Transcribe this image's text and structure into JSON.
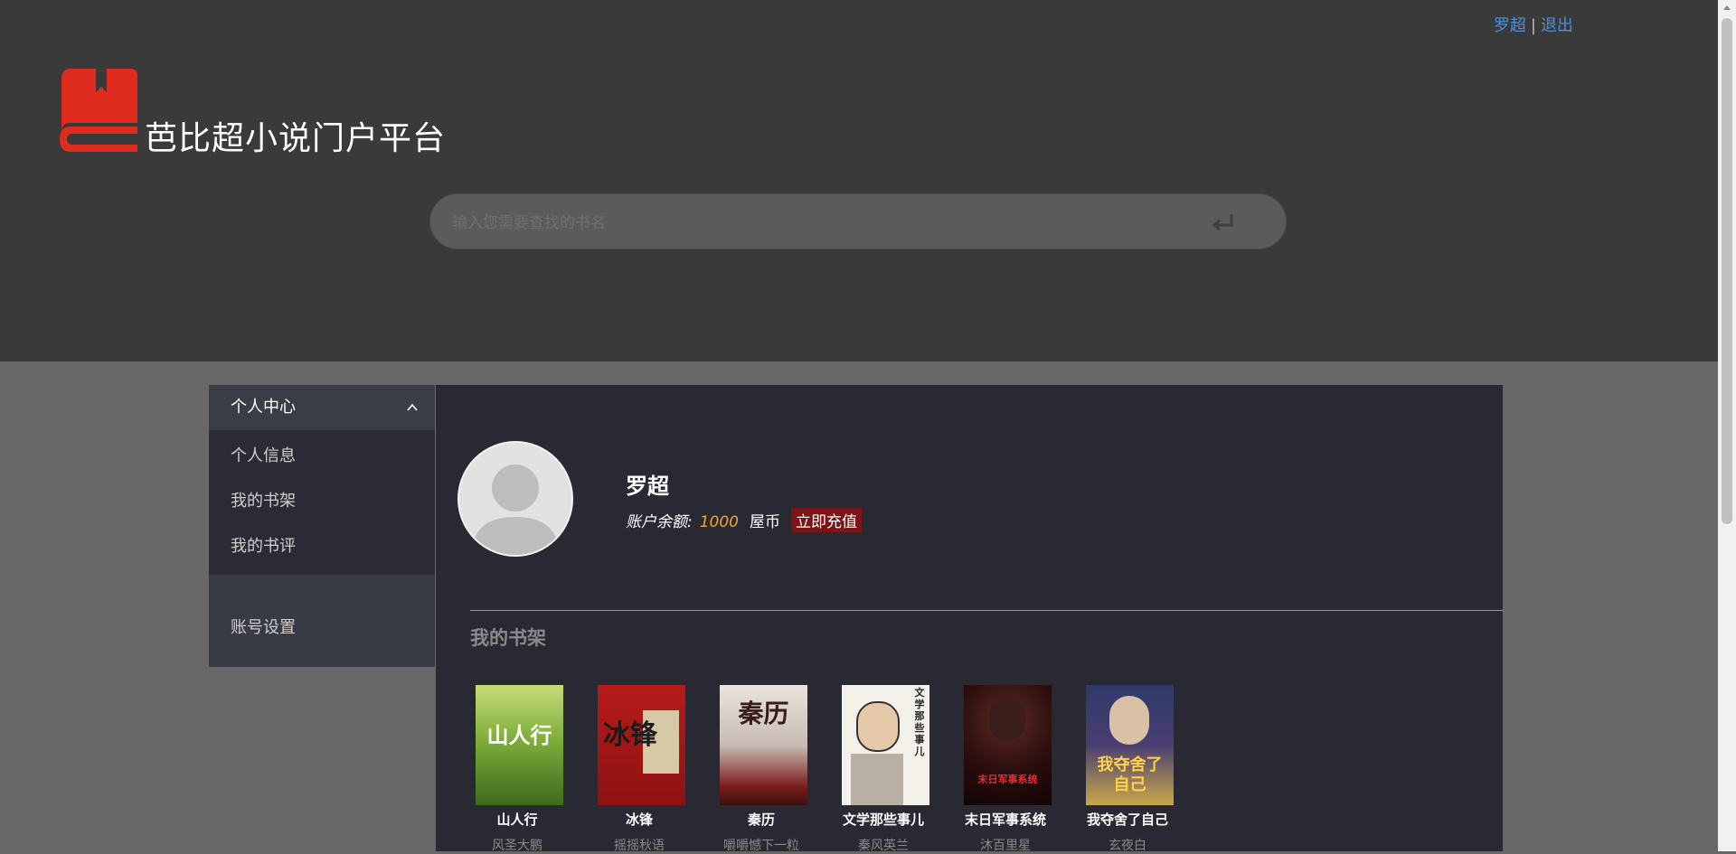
{
  "header": {
    "user_link": "罗超",
    "separator": "|",
    "logout_link": "退出",
    "site_title": "芭比超小说门户平台",
    "search": {
      "placeholder": "输入您需要查找的书名",
      "value": ""
    }
  },
  "sidebar": {
    "section_title": "个人中心",
    "items": [
      {
        "label": "个人信息"
      },
      {
        "label": "我的书架"
      },
      {
        "label": "我的书评"
      }
    ],
    "settings_label": "账号设置"
  },
  "profile": {
    "name": "罗超",
    "balance_label": "账户余额:",
    "balance_value": "1000",
    "currency": "屋币",
    "recharge_label": "立即充值"
  },
  "shelf": {
    "title": "我的书架",
    "books": [
      {
        "title": "山人行",
        "author": "风圣大鹏",
        "cover_text": "山人行"
      },
      {
        "title": "冰锋",
        "author": "摇摇秋语",
        "cover_text": "冰锋"
      },
      {
        "title": "秦历",
        "author": "嚼嚼憾下一粒",
        "cover_text": "秦历"
      },
      {
        "title": "文学那些事儿",
        "author": "秦风英兰",
        "cover_text": "文学那些事儿"
      },
      {
        "title": "末日军事系统",
        "author": "沐百里星",
        "cover_text": "末日军事系统"
      },
      {
        "title": "我夺舍了自己",
        "author": "玄夜白",
        "cover_text": "我夺舍了自己"
      }
    ]
  },
  "colors": {
    "header_bg": "#3a3a3b",
    "page_bg": "#686868",
    "content_bg": "#282932",
    "link": "#4a90e2",
    "balance": "#f5a623",
    "recharge_bg": "#7a1416",
    "logo": "#e02b1f"
  }
}
